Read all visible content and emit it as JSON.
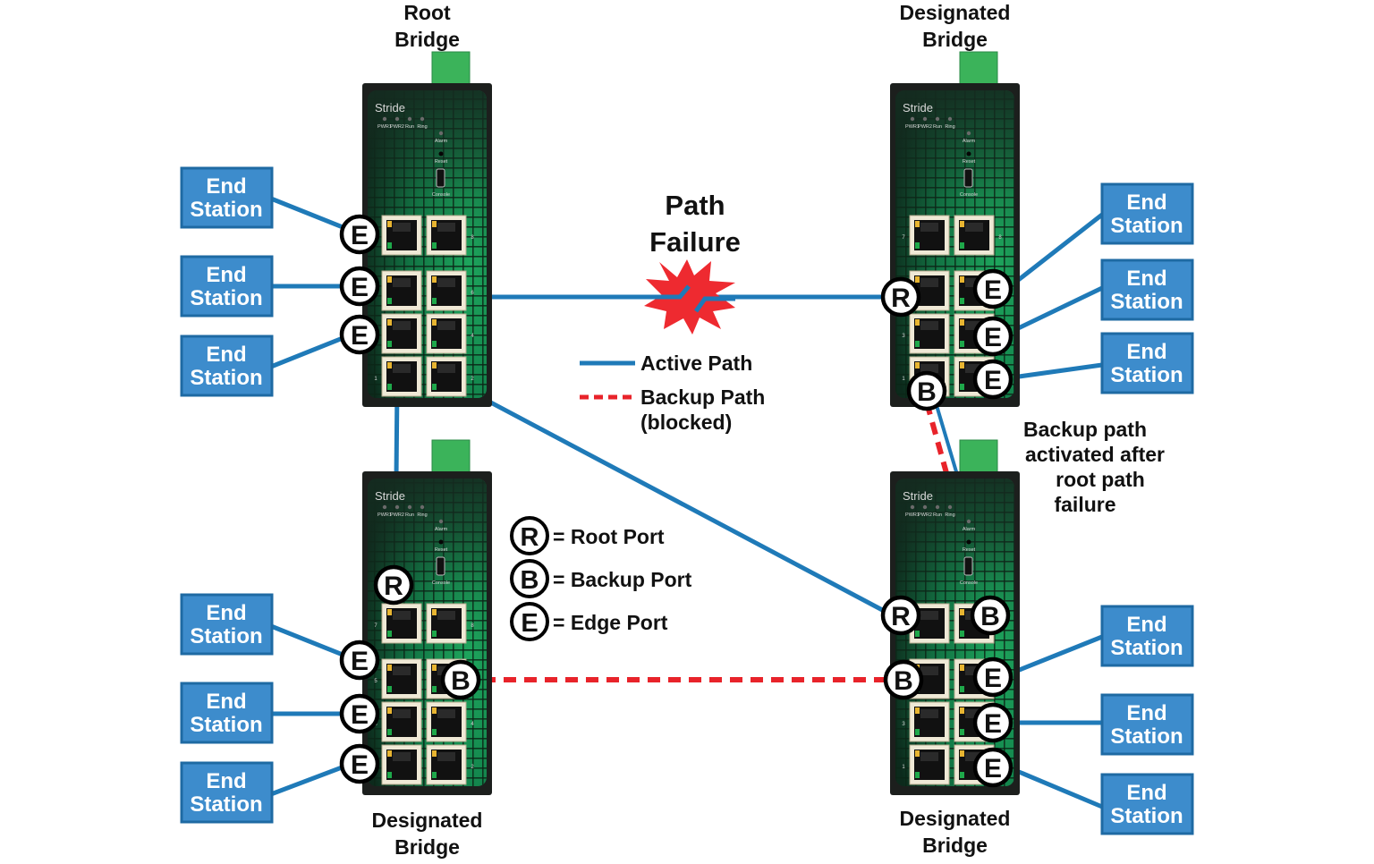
{
  "colors": {
    "active_path": "#1f7ab8",
    "backup_path": "#e8232a",
    "end_station_fill": "#3d8ccc",
    "end_station_border": "#1e6aa3",
    "switch_body": "#1c1f1d",
    "switch_green": "#1fa85a",
    "connector_green": "#3bb35a",
    "burst": "#ee2a30"
  },
  "switches": {
    "root": {
      "title_line1": "Root",
      "title_line2": "Bridge",
      "brand": "Stride",
      "leds": [
        "PWR1",
        "PWR2",
        "Run",
        "Ring"
      ],
      "alarm": "Alarm",
      "reset": "Reset",
      "console": "Console"
    },
    "top_right": {
      "title_line1": "Designated",
      "title_line2": "Bridge",
      "brand": "Stride",
      "leds": [
        "PWR1",
        "PWR2",
        "Run",
        "Ring"
      ],
      "alarm": "Alarm",
      "reset": "Reset",
      "console": "Console"
    },
    "bottom_left": {
      "title_line1": "Designated",
      "title_line2": "Bridge",
      "brand": "Stride",
      "leds": [
        "PWR1",
        "PWR2",
        "Run",
        "Ring"
      ],
      "alarm": "Alarm",
      "reset": "Reset",
      "console": "Console"
    },
    "bottom_right": {
      "title_line1": "Designated",
      "title_line2": "Bridge",
      "brand": "Stride",
      "leds": [
        "PWR1",
        "PWR2",
        "Run",
        "Ring"
      ],
      "alarm": "Alarm",
      "reset": "Reset",
      "console": "Console"
    }
  },
  "port_numbers": [
    "7",
    "8",
    "5",
    "6",
    "3",
    "4",
    "1",
    "2"
  ],
  "end_station": {
    "line1": "End",
    "line2": "Station"
  },
  "badges": {
    "root": "R",
    "backup": "B",
    "edge": "E"
  },
  "failure": {
    "line1": "Path",
    "line2": "Failure"
  },
  "legend": {
    "active": "Active Path",
    "backup_line1": "Backup Path",
    "backup_line2": "(blocked)"
  },
  "port_legend": [
    {
      "letter": "R",
      "label": "= Root Port"
    },
    {
      "letter": "B",
      "label": "= Backup Port"
    },
    {
      "letter": "E",
      "label": "= Edge Port"
    }
  ],
  "annotation": {
    "line1": "Backup path",
    "line2": "activated after",
    "line3": "root path",
    "line4": "failure"
  }
}
